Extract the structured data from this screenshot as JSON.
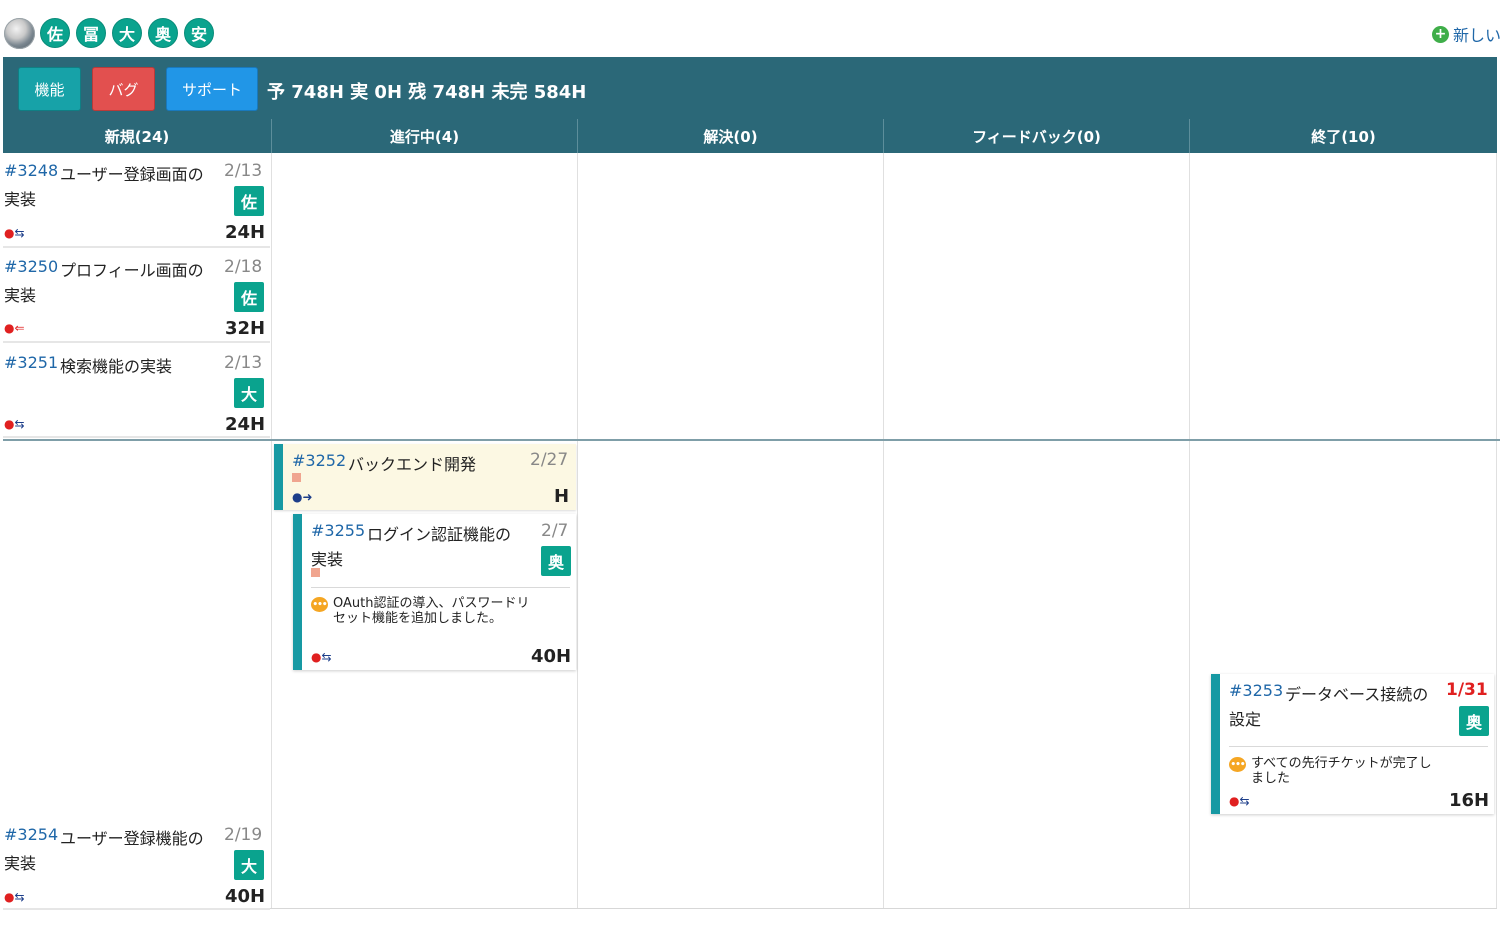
{
  "avatars": [
    "佐",
    "冨",
    "大",
    "奥",
    "安"
  ],
  "new_link": "新しい",
  "toolbar": {
    "feature_label": "機能",
    "bug_label": "バグ",
    "support_label": "サポート",
    "summary": "予 748H 実 0H 残 748H 未完 584H"
  },
  "columns": [
    "新規(24)",
    "進行中(4)",
    "解決(0)",
    "フィードバック(0)",
    "終了(10)"
  ],
  "colors": {
    "header_bg": "#2b6878",
    "feature_btn": "#17a2a8",
    "bug_btn": "#e2504f",
    "support_btn": "#2196e7",
    "assignee_badge": "#0aa38e",
    "overdue_date": "#e02020",
    "parent_card_bg": "#fcf8e3",
    "accent_bar": "#1799a3"
  },
  "cards": {
    "c3248": {
      "num": "#3248",
      "title1": "ユーザー登録画面の",
      "title2": "実装",
      "date": "2/13",
      "assignee": "佐",
      "hours": "24H"
    },
    "c3250": {
      "num": "#3250",
      "title1": "プロフィール画面の",
      "title2": "実装",
      "date": "2/18",
      "assignee": "佐",
      "hours": "32H"
    },
    "c3251": {
      "num": "#3251",
      "title1": "検索機能の実装",
      "date": "2/13",
      "assignee": "大",
      "hours": "24H"
    },
    "c3252": {
      "num": "#3252",
      "title1": "バックエンド開発",
      "date": "2/27",
      "hours": "H"
    },
    "c3255": {
      "num": "#3255",
      "title1": "ログイン認証機能の",
      "title2": "実装",
      "date": "2/7",
      "assignee": "奥",
      "note": "OAuth認証の導入、パスワードリセット機能を追加しました。",
      "hours": "40H"
    },
    "c3253": {
      "num": "#3253",
      "title1": "データベース接続の",
      "title2": "設定",
      "date": "1/31",
      "assignee": "奥",
      "note": "すべての先行チケットが完了しました",
      "hours": "16H"
    },
    "c3254": {
      "num": "#3254",
      "title1": "ユーザー登録機能の",
      "title2": "実装",
      "date": "2/19",
      "assignee": "大",
      "hours": "40H"
    }
  }
}
